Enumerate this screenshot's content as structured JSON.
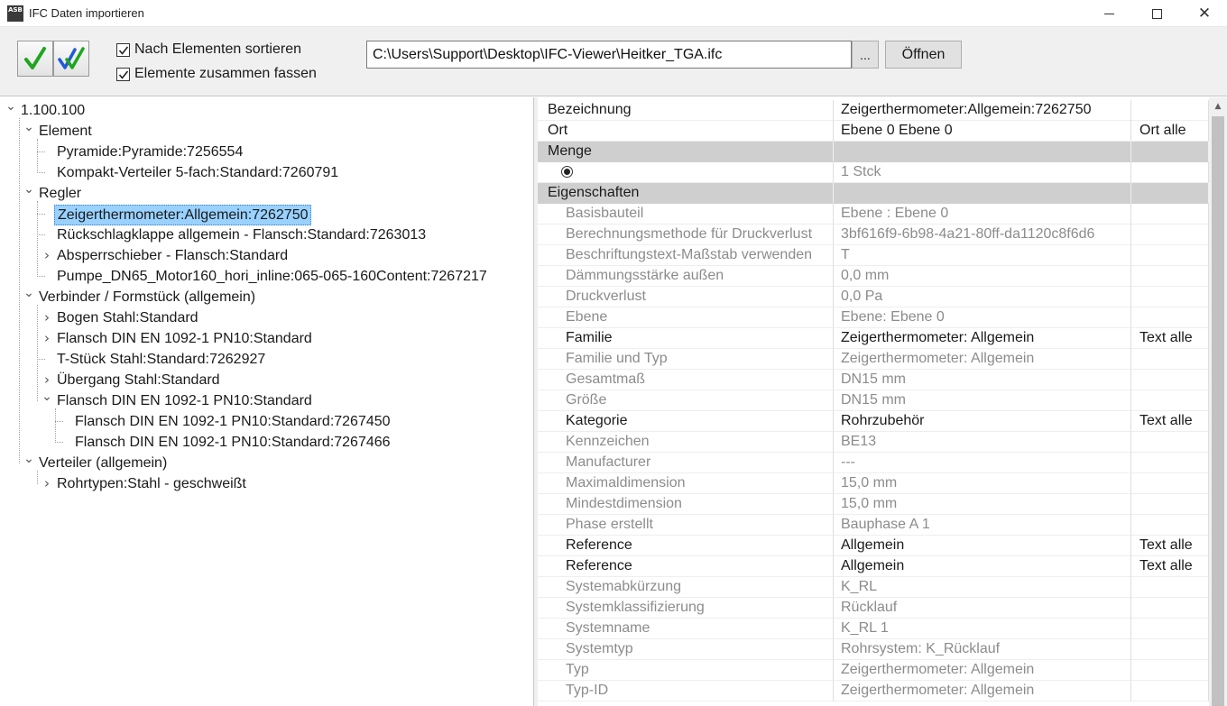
{
  "window": {
    "icon_text": "ASB",
    "title": "IFC Daten importieren",
    "minimize_glyph": "",
    "close_glyph": "✕"
  },
  "toolbar": {
    "option_sort": "Nach Elementen sortieren",
    "option_merge": "Elemente zusammen fassen",
    "path_value": "C:\\Users\\Support\\Desktop\\IFC-Viewer\\Heitker_TGA.ifc",
    "browse_label": "...",
    "open_label": "Öffnen",
    "accent_green": "#1fa51f",
    "accent_blue": "#1e5bd6"
  },
  "tree": [
    {
      "label": "1.100.100",
      "level": 0,
      "toggle": "expanded"
    },
    {
      "label": "Element",
      "level": 1,
      "toggle": "expanded"
    },
    {
      "label": "Pyramide:Pyramide:7256554",
      "level": 2,
      "toggle": "none"
    },
    {
      "label": "Kompakt-Verteiler 5-fach:Standard:7260791",
      "level": 2,
      "toggle": "none"
    },
    {
      "label": "Regler",
      "level": 1,
      "toggle": "expanded"
    },
    {
      "label": "Zeigerthermometer:Allgemein:7262750",
      "level": 2,
      "toggle": "none",
      "selected": true
    },
    {
      "label": "Rückschlagklappe allgemein - Flansch:Standard:7263013",
      "level": 2,
      "toggle": "none"
    },
    {
      "label": "Absperrschieber - Flansch:Standard",
      "level": 2,
      "toggle": "collapsed"
    },
    {
      "label": "Pumpe_DN65_Motor160_hori_inline:065-065-160Content:7267217",
      "level": 2,
      "toggle": "none"
    },
    {
      "label": "Verbinder / Formstück (allgemein)",
      "level": 1,
      "toggle": "expanded"
    },
    {
      "label": "Bogen Stahl:Standard",
      "level": 2,
      "toggle": "collapsed"
    },
    {
      "label": "Flansch DIN EN 1092-1 PN10:Standard",
      "level": 2,
      "toggle": "collapsed"
    },
    {
      "label": "T-Stück Stahl:Standard:7262927",
      "level": 2,
      "toggle": "none"
    },
    {
      "label": "Übergang Stahl:Standard",
      "level": 2,
      "toggle": "collapsed"
    },
    {
      "label": "Flansch DIN EN 1092-1 PN10:Standard",
      "level": 2,
      "toggle": "expanded"
    },
    {
      "label": "Flansch DIN EN 1092-1 PN10:Standard:7267450",
      "level": 3,
      "toggle": "none"
    },
    {
      "label": "Flansch DIN EN 1092-1 PN10:Standard:7267466",
      "level": 3,
      "toggle": "none"
    },
    {
      "label": "Verteiler (allgemein)",
      "level": 1,
      "toggle": "expanded"
    },
    {
      "label": "Rohrtypen:Stahl - geschweißt",
      "level": 2,
      "toggle": "collapsed"
    }
  ],
  "properties": [
    {
      "kind": "row",
      "name": "Bezeichnung",
      "value": "Zeigerthermometer:Allgemein:7262750",
      "action": ""
    },
    {
      "kind": "row",
      "name": "Ort",
      "value": "Ebene 0 Ebene 0",
      "action": "Ort alle"
    },
    {
      "kind": "group",
      "name": "Menge",
      "value": "",
      "action": ""
    },
    {
      "kind": "radio",
      "name": "",
      "value": "1 Stck",
      "action": ""
    },
    {
      "kind": "group",
      "name": "Eigenschaften",
      "value": "",
      "action": ""
    },
    {
      "kind": "dim",
      "name": "Basisbauteil",
      "value": "Ebene : Ebene 0",
      "action": ""
    },
    {
      "kind": "dim",
      "name": "Berechnungsmethode für Druckverlust",
      "value": "3bf616f9-6b98-4a21-80ff-da1120c8f6d6",
      "action": ""
    },
    {
      "kind": "dim",
      "name": "Beschriftungstext-Maßstab verwenden",
      "value": "T",
      "action": ""
    },
    {
      "kind": "dim",
      "name": "Dämmungsstärke außen",
      "value": "0,0 mm",
      "action": ""
    },
    {
      "kind": "dim",
      "name": "Druckverlust",
      "value": "0,0 Pa",
      "action": ""
    },
    {
      "kind": "dim",
      "name": "Ebene",
      "value": "Ebene: Ebene 0",
      "action": ""
    },
    {
      "kind": "active",
      "name": "Familie",
      "value": "Zeigerthermometer: Allgemein",
      "action": "Text alle"
    },
    {
      "kind": "dim",
      "name": "Familie und Typ",
      "value": "Zeigerthermometer: Allgemein",
      "action": ""
    },
    {
      "kind": "dim",
      "name": "Gesamtmaß",
      "value": "DN15 mm",
      "action": ""
    },
    {
      "kind": "dim",
      "name": "Größe",
      "value": "DN15 mm",
      "action": ""
    },
    {
      "kind": "active",
      "name": "Kategorie",
      "value": "Rohrzubehör",
      "action": "Text alle"
    },
    {
      "kind": "dim",
      "name": "Kennzeichen",
      "value": "BE13",
      "action": ""
    },
    {
      "kind": "dim",
      "name": "Manufacturer",
      "value": "---",
      "action": ""
    },
    {
      "kind": "dim",
      "name": "Maximaldimension",
      "value": "15,0 mm",
      "action": ""
    },
    {
      "kind": "dim",
      "name": "Mindestdimension",
      "value": "15,0 mm",
      "action": ""
    },
    {
      "kind": "dim",
      "name": "Phase erstellt",
      "value": "Bauphase A 1",
      "action": ""
    },
    {
      "kind": "active",
      "name": "Reference",
      "value": "Allgemein",
      "action": "Text alle"
    },
    {
      "kind": "active",
      "name": "Reference",
      "value": "Allgemein",
      "action": "Text alle"
    },
    {
      "kind": "dim",
      "name": "Systemabkürzung",
      "value": "K_RL",
      "action": ""
    },
    {
      "kind": "dim",
      "name": "Systemklassifizierung",
      "value": "Rücklauf",
      "action": ""
    },
    {
      "kind": "dim",
      "name": "Systemname",
      "value": "K_RL 1",
      "action": ""
    },
    {
      "kind": "dim",
      "name": "Systemtyp",
      "value": "Rohrsystem: K_Rücklauf",
      "action": ""
    },
    {
      "kind": "dim",
      "name": "Typ",
      "value": "Zeigerthermometer: Allgemein",
      "action": ""
    },
    {
      "kind": "dim",
      "name": "Typ-ID",
      "value": "Zeigerthermometer: Allgemein",
      "action": ""
    }
  ],
  "scrollbar": {
    "up_glyph": "▲"
  }
}
